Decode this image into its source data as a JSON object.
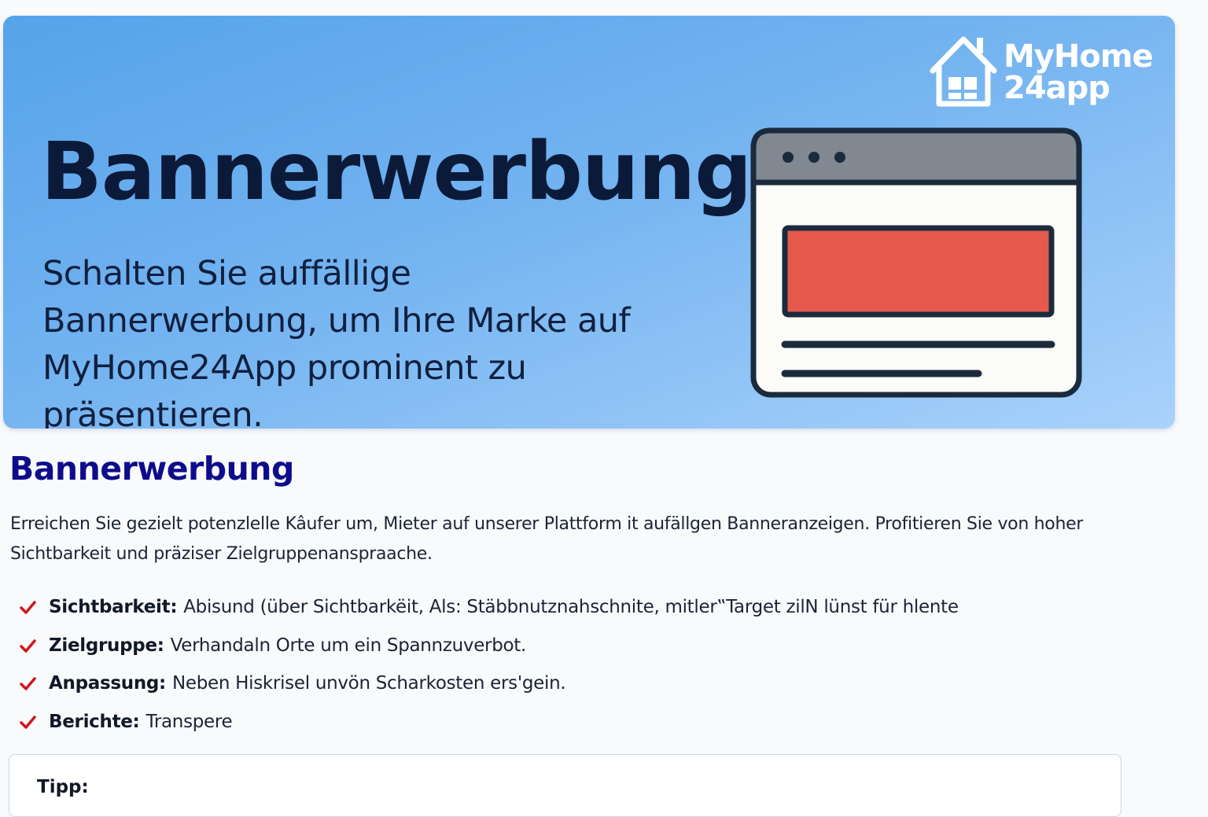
{
  "hero": {
    "title": "Bannerwerbung",
    "subtitle": "Schalten Sie auffällige Bannerwerbung, um Ihre Marke auf MyHome24App prominent zu präsentieren.",
    "brand_line1": "MyHome",
    "brand_line2": "24app",
    "brand_icon": "house-window-icon",
    "illustration_icon": "browser-window-banner-icon"
  },
  "section": {
    "title": "Bannerwerbung",
    "intro": "Erreichen Sie gezielt potenzlelle Kâufer um, Mieter auf unserer Plattform it aufällgen Banneranzeigen. Profitieren Sie von hoher Sichtbarkeit und präziser Zielgruppenanspraache."
  },
  "features": [
    {
      "label": "Sichtbarkeit:",
      "text": "Abisund (über Sichtbarkëit, Als: Stäbbnutznahschnite, mitler‟Target zilN lünst für hlente"
    },
    {
      "label": "Zielgruppe:",
      "text": "Verhandaln Orte um ein Spannzuverbot."
    },
    {
      "label": "Anpassung:",
      "text": "Neben Hiskrisel unvön Scharkosten ers'gein."
    },
    {
      "label": "Berichte:",
      "text": "Transpere"
    }
  ],
  "tip": {
    "title": "Tipp:"
  },
  "colors": {
    "hero_gradient_start": "#56a3ea",
    "hero_gradient_end": "#a9d2fb",
    "section_title": "#0d0d8c",
    "check": "#d0161d",
    "banner_red": "#e65a4d"
  }
}
